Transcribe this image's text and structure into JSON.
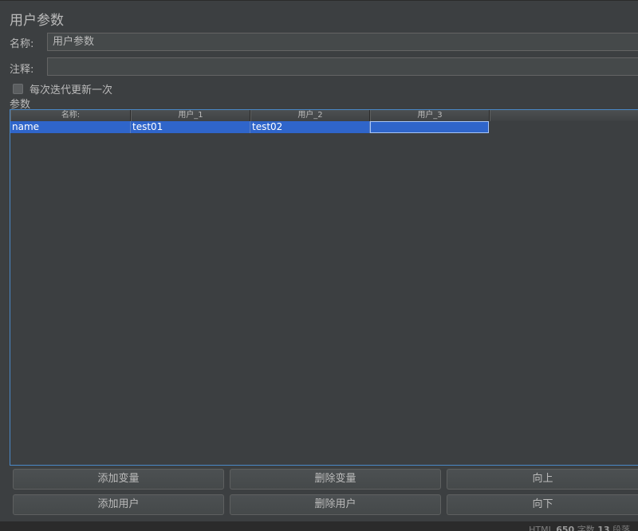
{
  "panel": {
    "title": "用户参数"
  },
  "name_field": {
    "label": "名称:",
    "value": "用户参数"
  },
  "comment_field": {
    "label": "注释:",
    "value": ""
  },
  "update_once": {
    "label": "每次迭代更新一次",
    "checked": false
  },
  "params": {
    "label": "参数",
    "columns": [
      "名称:",
      "用户_1",
      "用户_2",
      "用户_3"
    ],
    "rows": [
      [
        "name",
        "test01",
        "test02",
        ""
      ]
    ]
  },
  "buttons": {
    "add_variable": "添加变量",
    "delete_variable": "删除变量",
    "move_up": "向上",
    "add_user": "添加用户",
    "delete_user": "删除用户",
    "move_down": "向下"
  },
  "status": {
    "prefix": "HTML",
    "word_count": "650",
    "word_unit": "字数",
    "para_count": "13",
    "para_unit": "段落"
  },
  "colors": {
    "selection": "#2f65ca",
    "focus_border": "#4a88c7",
    "background": "#3c3f41"
  }
}
